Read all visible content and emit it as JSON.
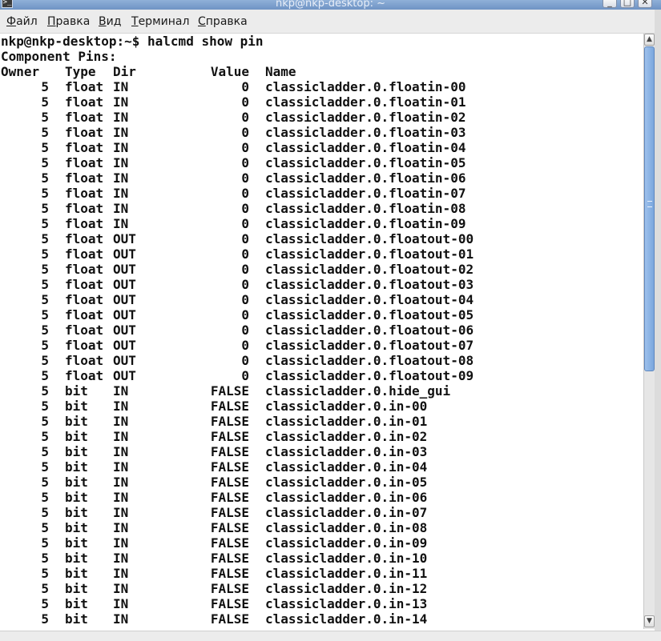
{
  "window": {
    "title": "nkp@nkp-desktop: ~",
    "minimize_label": "_",
    "maximize_label": "□",
    "close_label": "✕"
  },
  "menu": [
    {
      "label": "Файл",
      "mnemonic": "Ф",
      "rest": "айл"
    },
    {
      "label": "Правка",
      "mnemonic": "П",
      "rest": "равка"
    },
    {
      "label": "Вид",
      "mnemonic": "В",
      "rest": "ид"
    },
    {
      "label": "Терминал",
      "mnemonic": "Т",
      "rest": "ерминал"
    },
    {
      "label": "Справка",
      "mnemonic": "С",
      "rest": "правка"
    }
  ],
  "terminal": {
    "prompt_line": "nkp@nkp-desktop:~$ halcmd show pin",
    "heading": "Component Pins:",
    "columns": {
      "owner": "Owner",
      "type": "Type",
      "dir": "Dir",
      "value": "Value",
      "name": "Name"
    },
    "rows": [
      {
        "owner": "5",
        "type": "float",
        "dir": "IN",
        "value": "0",
        "name": "classicladder.0.floatin-00"
      },
      {
        "owner": "5",
        "type": "float",
        "dir": "IN",
        "value": "0",
        "name": "classicladder.0.floatin-01"
      },
      {
        "owner": "5",
        "type": "float",
        "dir": "IN",
        "value": "0",
        "name": "classicladder.0.floatin-02"
      },
      {
        "owner": "5",
        "type": "float",
        "dir": "IN",
        "value": "0",
        "name": "classicladder.0.floatin-03"
      },
      {
        "owner": "5",
        "type": "float",
        "dir": "IN",
        "value": "0",
        "name": "classicladder.0.floatin-04"
      },
      {
        "owner": "5",
        "type": "float",
        "dir": "IN",
        "value": "0",
        "name": "classicladder.0.floatin-05"
      },
      {
        "owner": "5",
        "type": "float",
        "dir": "IN",
        "value": "0",
        "name": "classicladder.0.floatin-06"
      },
      {
        "owner": "5",
        "type": "float",
        "dir": "IN",
        "value": "0",
        "name": "classicladder.0.floatin-07"
      },
      {
        "owner": "5",
        "type": "float",
        "dir": "IN",
        "value": "0",
        "name": "classicladder.0.floatin-08"
      },
      {
        "owner": "5",
        "type": "float",
        "dir": "IN",
        "value": "0",
        "name": "classicladder.0.floatin-09"
      },
      {
        "owner": "5",
        "type": "float",
        "dir": "OUT",
        "value": "0",
        "name": "classicladder.0.floatout-00"
      },
      {
        "owner": "5",
        "type": "float",
        "dir": "OUT",
        "value": "0",
        "name": "classicladder.0.floatout-01"
      },
      {
        "owner": "5",
        "type": "float",
        "dir": "OUT",
        "value": "0",
        "name": "classicladder.0.floatout-02"
      },
      {
        "owner": "5",
        "type": "float",
        "dir": "OUT",
        "value": "0",
        "name": "classicladder.0.floatout-03"
      },
      {
        "owner": "5",
        "type": "float",
        "dir": "OUT",
        "value": "0",
        "name": "classicladder.0.floatout-04"
      },
      {
        "owner": "5",
        "type": "float",
        "dir": "OUT",
        "value": "0",
        "name": "classicladder.0.floatout-05"
      },
      {
        "owner": "5",
        "type": "float",
        "dir": "OUT",
        "value": "0",
        "name": "classicladder.0.floatout-06"
      },
      {
        "owner": "5",
        "type": "float",
        "dir": "OUT",
        "value": "0",
        "name": "classicladder.0.floatout-07"
      },
      {
        "owner": "5",
        "type": "float",
        "dir": "OUT",
        "value": "0",
        "name": "classicladder.0.floatout-08"
      },
      {
        "owner": "5",
        "type": "float",
        "dir": "OUT",
        "value": "0",
        "name": "classicladder.0.floatout-09"
      },
      {
        "owner": "5",
        "type": "bit",
        "dir": "IN",
        "value": "FALSE",
        "name": "classicladder.0.hide_gui"
      },
      {
        "owner": "5",
        "type": "bit",
        "dir": "IN",
        "value": "FALSE",
        "name": "classicladder.0.in-00"
      },
      {
        "owner": "5",
        "type": "bit",
        "dir": "IN",
        "value": "FALSE",
        "name": "classicladder.0.in-01"
      },
      {
        "owner": "5",
        "type": "bit",
        "dir": "IN",
        "value": "FALSE",
        "name": "classicladder.0.in-02"
      },
      {
        "owner": "5",
        "type": "bit",
        "dir": "IN",
        "value": "FALSE",
        "name": "classicladder.0.in-03"
      },
      {
        "owner": "5",
        "type": "bit",
        "dir": "IN",
        "value": "FALSE",
        "name": "classicladder.0.in-04"
      },
      {
        "owner": "5",
        "type": "bit",
        "dir": "IN",
        "value": "FALSE",
        "name": "classicladder.0.in-05"
      },
      {
        "owner": "5",
        "type": "bit",
        "dir": "IN",
        "value": "FALSE",
        "name": "classicladder.0.in-06"
      },
      {
        "owner": "5",
        "type": "bit",
        "dir": "IN",
        "value": "FALSE",
        "name": "classicladder.0.in-07"
      },
      {
        "owner": "5",
        "type": "bit",
        "dir": "IN",
        "value": "FALSE",
        "name": "classicladder.0.in-08"
      },
      {
        "owner": "5",
        "type": "bit",
        "dir": "IN",
        "value": "FALSE",
        "name": "classicladder.0.in-09"
      },
      {
        "owner": "5",
        "type": "bit",
        "dir": "IN",
        "value": "FALSE",
        "name": "classicladder.0.in-10"
      },
      {
        "owner": "5",
        "type": "bit",
        "dir": "IN",
        "value": "FALSE",
        "name": "classicladder.0.in-11"
      },
      {
        "owner": "5",
        "type": "bit",
        "dir": "IN",
        "value": "FALSE",
        "name": "classicladder.0.in-12"
      },
      {
        "owner": "5",
        "type": "bit",
        "dir": "IN",
        "value": "FALSE",
        "name": "classicladder.0.in-13"
      },
      {
        "owner": "5",
        "type": "bit",
        "dir": "IN",
        "value": "FALSE",
        "name": "classicladder.0.in-14"
      }
    ]
  },
  "icons": {
    "app": "terminal-icon",
    "scroll_up": "arrow-up-icon",
    "scroll_down": "arrow-down-icon"
  }
}
